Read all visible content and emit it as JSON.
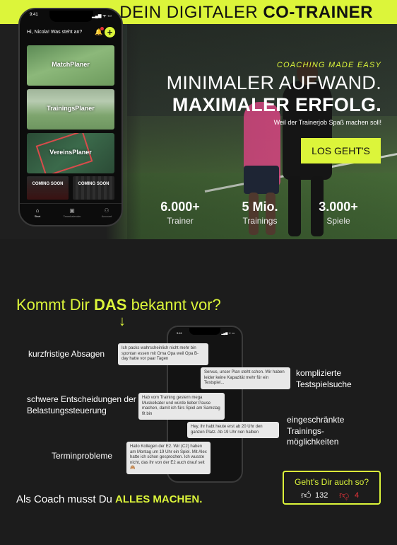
{
  "header": {
    "brand_light": "DEIN DIGITALER ",
    "brand_bold": "CO-TRAINER"
  },
  "hero": {
    "tagline": "COACHING MADE EASY",
    "headline_light": "MINIMALER AUFWAND.",
    "headline_bold": "MAXIMALER ERFOLG.",
    "subline": "Weil der Trainerjob Spaß machen soll!",
    "cta_label": "LOS GEHT'S",
    "stats": [
      {
        "value": "6.000+",
        "label": "Trainer"
      },
      {
        "value": "5 Mio.",
        "label": "Trainings"
      },
      {
        "value": "3.000+",
        "label": "Spiele"
      }
    ]
  },
  "app": {
    "time": "9:41",
    "status": "▂▄▆ ᯤ ▭",
    "greeting": "Hi, Nicola! Was steht an?",
    "cards": [
      "MatchPlaner",
      "TrainingsPlaner",
      "VereinsPlaner"
    ],
    "coming_soon": [
      "COMING SOON",
      "COMING SOON"
    ],
    "tabs": [
      "Start",
      "Teamkalender",
      "Account"
    ]
  },
  "section2": {
    "question_pre": "Kommt Dir ",
    "question_bold": "DAS",
    "question_post": " bekannt vor?",
    "arrow": "↓",
    "phone_time": "9:41",
    "phone_status": "▂▄▆ ᯤ ▭",
    "bubbles": [
      "Ich packs wahrscheinlich nicht mehr bin spontan essen mit Oma Opa weil Opa B-day hatte vor paar Tagen",
      "Servus, unser Plan steht schon. Wir haben leider keine Kapazität mehr für ein Testspiel...",
      "Hab vom Training gestern mega Muskelkater und würde lieber Pause machen, damit ich fürs Spiel am Samstag fit bin",
      "Hey, ihr habt heute erst ab 20 Uhr den ganzen Platz. Ab 19 Uhr nen halben",
      "Hallo Kollegen der E2. Wir (C2) haben am Montag um 19 Uhr ein Spiel. Mit Alex hatte ich schon gesprochen. Ich wusste nicht, das ihr von der E2 auch drauf seit 🙈"
    ],
    "pain_points": [
      "kurzfristige Absagen",
      "komplizierte Testspielsuche",
      "schwere Entscheidungen der Belastungssteuerung",
      "eingeschränkte Trainings-möglichkeiten",
      "Terminprobleme"
    ],
    "coach_pre": "Als Coach musst Du ",
    "coach_bold": "ALLES MACHEN.",
    "poll": {
      "question": "Geht's Dir auch so?",
      "up_icon": "thumbs-up",
      "up": "132",
      "down_icon": "thumbs-down",
      "down": "4"
    }
  },
  "colors": {
    "accent": "#dcf53a",
    "bg": "#1c1c1c",
    "negative": "#e6333a"
  }
}
